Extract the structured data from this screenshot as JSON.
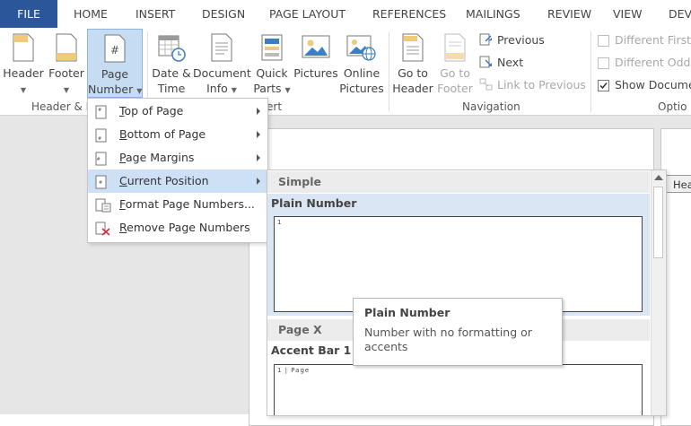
{
  "tabs": [
    "FILE",
    "HOME",
    "INSERT",
    "DESIGN",
    "PAGE LAYOUT",
    "REFERENCES",
    "MAILINGS",
    "REVIEW",
    "VIEW",
    "DEVE"
  ],
  "ribbon": {
    "header": "Header",
    "footer": "Footer",
    "page_number": [
      "Page",
      "Number"
    ],
    "date_time": [
      "Date &",
      "Time"
    ],
    "document_info": [
      "Document",
      "Info"
    ],
    "quick_parts": [
      "Quick",
      "Parts"
    ],
    "pictures": "Pictures",
    "online_pictures": [
      "Online",
      "Pictures"
    ],
    "go_to_header": [
      "Go to",
      "Header"
    ],
    "go_to_footer": [
      "Go to",
      "Footer"
    ],
    "previous": "Previous",
    "next": "Next",
    "link_to_previous": "Link to Previous",
    "different_first": "Different First P",
    "different_odd": "Different Odd &",
    "show_document": "Show Docume",
    "groups": {
      "header_footer": "Header & F",
      "insert": "ert",
      "navigation": "Navigation",
      "options": "Optio"
    }
  },
  "menu": {
    "items": [
      {
        "label": "Top of Page",
        "accel": "T",
        "rest": "op of Page",
        "submenu": true
      },
      {
        "label": "Bottom of Page",
        "accel": "B",
        "rest": "ottom of Page",
        "submenu": true
      },
      {
        "label": "Page Margins",
        "accel": "P",
        "rest": "age Margins",
        "submenu": true
      },
      {
        "label": "Current Position",
        "accel": "C",
        "rest": "urrent Position",
        "submenu": true
      },
      {
        "label": "Format Page Numbers...",
        "accel": "F",
        "rest": "ormat Page Numbers...",
        "submenu": false
      },
      {
        "label": "Remove Page Numbers",
        "accel": "R",
        "rest": "emove Page Numbers",
        "submenu": false
      }
    ]
  },
  "gallery": {
    "section_simple": "Simple",
    "item1_title": "Plain Number",
    "item1_preview": "1",
    "section_page_x": "Page X",
    "item2_title": "Accent Bar 1",
    "item2_preview": "1 | Page"
  },
  "tooltip": {
    "title": "Plain Number",
    "body": "Number with no formatting or accents"
  },
  "doc_tab": "Hea",
  "colors": {
    "file_tab": "#2b579a",
    "highlight": "#cde0f5",
    "ribbon_button_active": "#c5dcf2"
  }
}
